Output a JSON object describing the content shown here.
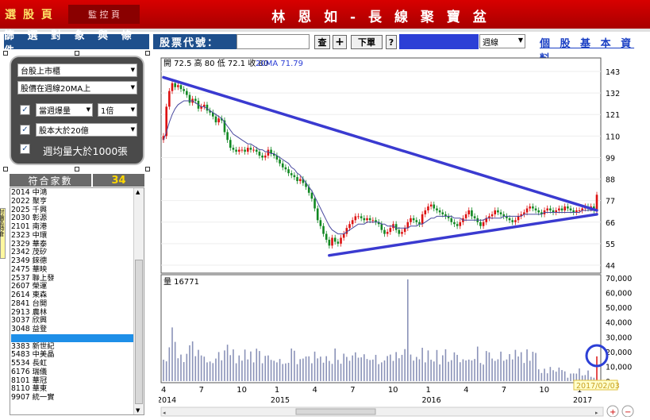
{
  "header": {
    "tab_main": "選 股 頁",
    "tab_ctrl": "監 控 頁",
    "title": "林 恩 如 - 長 線 聚 寶 盆"
  },
  "toolbar": {
    "filter_title": "篩 選 對 象 與 條 件",
    "stock_label": "股票代號：",
    "stock_value": "",
    "query": "查",
    "add": "+",
    "order": "下單",
    "help": "?",
    "period": "週線",
    "basic_link": "個 股 基 本 資 料"
  },
  "filters": {
    "market": "台股上市櫃",
    "ma_cond": "股價在週線20MA上",
    "vol_check": "✓",
    "vol_label": "當週爆量",
    "vol_mult": "1倍",
    "cap_check": "✓",
    "cap_label": "股本大於20億",
    "weekly_check": "✓",
    "weekly_label": "週均量大於1000張"
  },
  "count": {
    "label": "符合家數",
    "value": "34"
  },
  "list": [
    "2014 中鴻",
    "2022 聚亨",
    "2025 千興",
    "2030 彰源",
    "2101 南港",
    "2323 中環",
    "2329 華泰",
    "2342 茂矽",
    "2349 錸德",
    "2475 華映",
    "2537 聯上發",
    "2607 榮運",
    "2614 東森",
    "2841 台開",
    "2913 農林",
    "3037 欣興",
    "3048 益登",
    "",
    "3383 新世紀",
    "5483 中美晶",
    "5534 長虹",
    "6176 瑞儀",
    "8101 華冠",
    "8110 華東",
    "9907 統一實"
  ],
  "side_tab": "討論區持倉",
  "chart_data": {
    "type": "candlestick",
    "price_info": "開 72.5 高 80 低 72.1 收 80",
    "ma_info": "20MA 71.79",
    "price_axis": [
      143,
      132,
      121,
      110,
      99,
      88,
      77,
      66,
      55,
      44
    ],
    "volume_info": "量 16771",
    "volume_axis": [
      "70,000",
      "60,000",
      "50,000",
      "40,000",
      "30,000",
      "20,000",
      "10,000",
      "0"
    ],
    "x_ticks": [
      "4",
      "7",
      "10",
      "1",
      "4",
      "7",
      "10",
      "1",
      "4",
      "7",
      "10",
      "1"
    ],
    "years": [
      "2014",
      "2015",
      "2016",
      "2017"
    ],
    "date_label": "2017/02/03",
    "ylim": [
      44,
      143
    ],
    "vol_ylim": [
      0,
      70000
    ],
    "close": [
      110,
      125,
      133,
      137,
      135,
      136,
      134,
      133,
      131,
      127,
      129,
      128,
      124,
      125,
      126,
      123,
      122,
      120,
      117,
      119,
      118,
      112,
      108,
      104,
      103,
      102,
      103,
      103,
      102,
      104,
      103,
      103,
      102,
      100,
      99,
      100,
      103,
      101,
      100,
      98,
      96,
      94,
      93,
      91,
      90,
      89,
      87,
      88,
      86,
      84,
      81,
      78,
      73,
      67,
      64,
      60,
      57,
      54,
      58,
      56,
      55,
      58,
      60,
      63,
      65,
      67,
      69,
      69,
      68,
      67,
      68,
      67,
      67,
      66,
      65,
      62,
      60,
      61,
      63,
      65,
      62,
      60,
      61,
      63,
      66,
      68,
      67,
      66,
      65,
      70,
      72,
      74,
      75,
      73,
      72,
      71,
      70,
      69,
      68,
      66,
      65,
      64,
      66,
      68,
      70,
      72,
      69,
      68,
      66,
      64,
      66,
      68,
      69,
      70,
      72,
      71,
      70,
      69,
      68,
      67,
      66,
      67,
      69,
      70,
      71,
      73,
      74,
      73,
      72,
      71,
      70,
      72,
      73,
      72,
      71,
      72,
      73,
      72,
      74,
      73,
      72,
      71,
      72,
      72,
      73,
      74,
      73,
      74,
      72,
      80
    ],
    "volume": [
      14500,
      13400,
      22900,
      36400,
      26600,
      15500,
      18000,
      12900,
      18500,
      24300,
      26900,
      16900,
      21200,
      17400,
      16600,
      12700,
      13300,
      12200,
      15300,
      19700,
      14100,
      20800,
      24700,
      17600,
      21500,
      12100,
      17400,
      13900,
      21400,
      14700,
      20100,
      12700,
      22000,
      20400,
      12100,
      17100,
      17400,
      14400,
      13800,
      12700,
      15000,
      11600,
      12000,
      12400,
      22100,
      20600,
      11500,
      14900,
      15300,
      16700,
      16800,
      12100,
      20000,
      15400,
      16600,
      12500,
      16900,
      13700,
      11700,
      22100,
      14400,
      11800,
      18600,
      16400,
      13800,
      17400,
      19500,
      15900,
      16100,
      18200,
      15000,
      14300,
      14600,
      17800,
      11500,
      12700,
      14000,
      17000,
      18000,
      13700,
      19700,
      15500,
      17800,
      21700,
      69000,
      18000,
      13900,
      16400,
      14800,
      22600,
      12700,
      20800,
      14500,
      13300,
      21100,
      11300,
      17500,
      21600,
      13100,
      14200,
      19500,
      17800,
      12800,
      14800,
      14000,
      14600,
      14000,
      15000,
      23400,
      12300,
      11200,
      20400,
      19500,
      15300,
      13700,
      14800,
      20000,
      13800,
      14700,
      18300,
      14700,
      21200,
      16700,
      19600,
      12300,
      21500,
      13800,
      19900,
      19100,
      8000,
      5500,
      8400,
      5300,
      9600,
      7400,
      6400,
      9200,
      7500,
      6600,
      2300,
      5100,
      5200,
      5100,
      8600,
      3800,
      4100,
      7200,
      2900,
      2300,
      16771
    ],
    "trendlines": [
      {
        "from": [
          0,
          140
        ],
        "to": [
          149,
          72
        ]
      },
      {
        "from": [
          57,
          49
        ],
        "to": [
          149,
          70
        ]
      }
    ],
    "ma": [
      108,
      112,
      117,
      121,
      124,
      126,
      127,
      128,
      128,
      128,
      128,
      127,
      126,
      125,
      125,
      124,
      123,
      122,
      121,
      120,
      119,
      117,
      115,
      113,
      111,
      110,
      109,
      108,
      107,
      106,
      106,
      105,
      104,
      103,
      103,
      102,
      102,
      101,
      101,
      100,
      99,
      98,
      97,
      96,
      94,
      93,
      91,
      90,
      88,
      86,
      84,
      82,
      79,
      76,
      73,
      70,
      67,
      64,
      62,
      61,
      60,
      60,
      60,
      61,
      62,
      63,
      64,
      65,
      65,
      65,
      66,
      66,
      66,
      66,
      66,
      65,
      65,
      64,
      64,
      64,
      63,
      63,
      63,
      63,
      63,
      64,
      64,
      64,
      65,
      65,
      66,
      67,
      68,
      68,
      69,
      69,
      69,
      69,
      69,
      69,
      68,
      68,
      68,
      67,
      67,
      67,
      67,
      67,
      67,
      67,
      67,
      68,
      68,
      68,
      68,
      68,
      68,
      69,
      69,
      69,
      69,
      69,
      69,
      69,
      70,
      70,
      70,
      70,
      70,
      70,
      70,
      71,
      71,
      71,
      71,
      71,
      71,
      71,
      71,
      71,
      71,
      71,
      71,
      71,
      72,
      72,
      72,
      72,
      72,
      72
    ]
  }
}
